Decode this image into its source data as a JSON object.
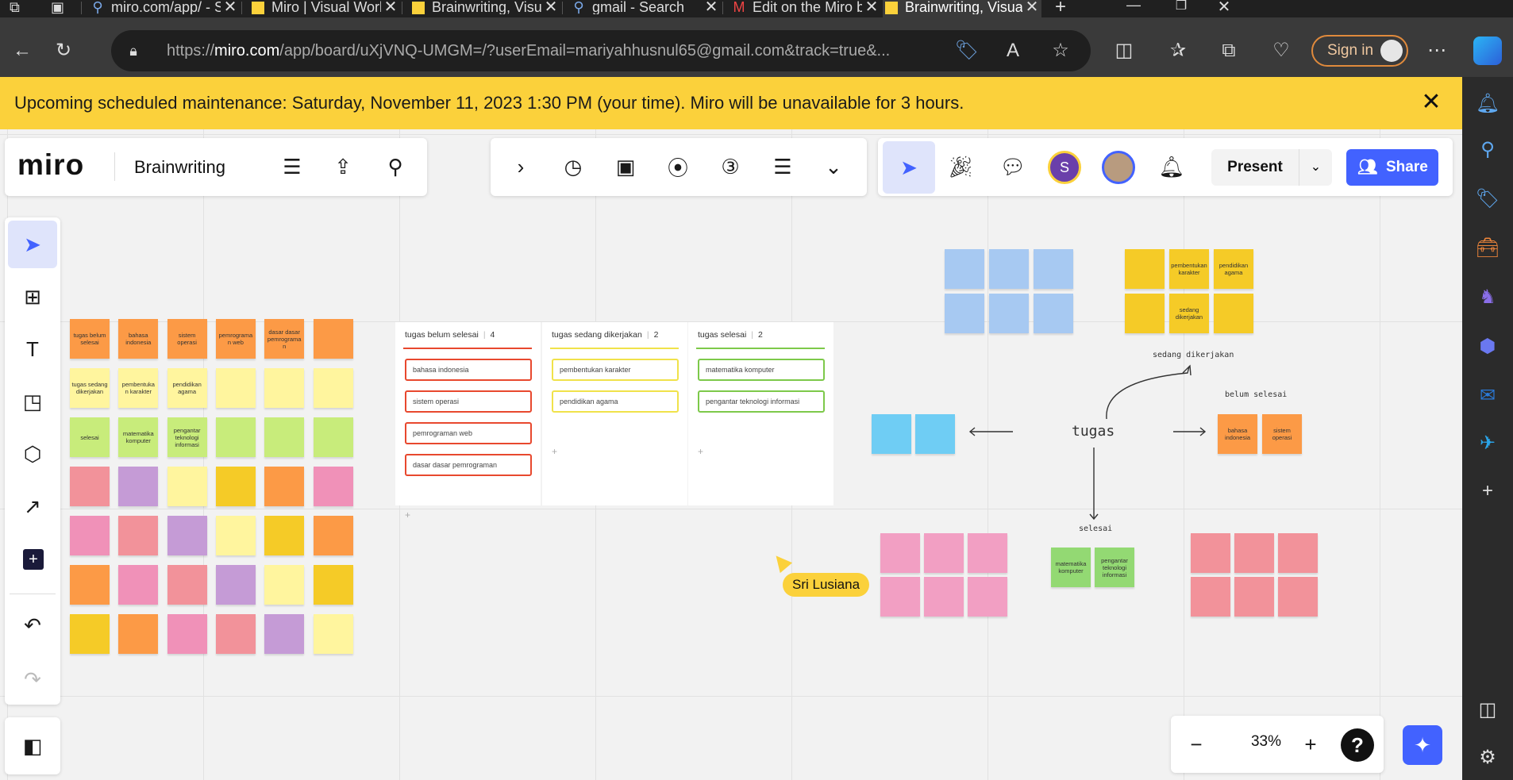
{
  "browser": {
    "tabs": [
      {
        "title": "miro.com/app/ - S",
        "active": false
      },
      {
        "title": "Miro | Visual Work",
        "active": false
      },
      {
        "title": "Brainwriting, Visua",
        "active": false
      },
      {
        "title": "gmail - Search",
        "active": false
      },
      {
        "title": "Edit on the Miro b",
        "active": false
      },
      {
        "title": "Brainwriting, Visua",
        "active": true
      }
    ],
    "url_prefix": "https://",
    "url_domain": "miro.com",
    "url_path": "/app/board/uXjVNQ-UMGM=/?userEmail=mariyahhusnul65@gmail.com&track=true&...",
    "sign_in_label": "Sign in"
  },
  "banner": {
    "text": "Upcoming scheduled maintenance: Saturday, November 11, 2023 1:30 PM (your time). Miro will be unavailable for 3 hours."
  },
  "board": {
    "logo": "miro",
    "name": "Brainwriting",
    "present_label": "Present",
    "share_label": "Share",
    "avatar_initial": "S",
    "zoom": "33%",
    "help": "?"
  },
  "cursor_user": "Sri Lusiana",
  "left_grid": [
    [
      {
        "c": "orange",
        "t": "tugas belum selesai"
      },
      {
        "c": "orange",
        "t": "bahasa indonesia"
      },
      {
        "c": "orange",
        "t": "sistem operasi"
      },
      {
        "c": "orange",
        "t": "pemrograma n web"
      },
      {
        "c": "orange",
        "t": "dasar dasar pemrograma n"
      },
      {
        "c": "orange",
        "t": ""
      }
    ],
    [
      {
        "c": "lyellow",
        "t": "tugas sedang dikerjakan"
      },
      {
        "c": "lyellow",
        "t": "pembentuka n karakter"
      },
      {
        "c": "lyellow",
        "t": "pendidikan agama"
      },
      {
        "c": "lyellow",
        "t": ""
      },
      {
        "c": "lyellow",
        "t": ""
      },
      {
        "c": "lyellow",
        "t": ""
      }
    ],
    [
      {
        "c": "green",
        "t": "selesai"
      },
      {
        "c": "green",
        "t": "matematika komputer"
      },
      {
        "c": "green",
        "t": "pengantar teknologi informasi"
      },
      {
        "c": "green",
        "t": ""
      },
      {
        "c": "green",
        "t": ""
      },
      {
        "c": "green",
        "t": ""
      }
    ],
    [
      {
        "c": "salmon",
        "t": ""
      },
      {
        "c": "purple",
        "t": ""
      },
      {
        "c": "lyellow",
        "t": ""
      },
      {
        "c": "yellow",
        "t": ""
      },
      {
        "c": "orange",
        "t": ""
      },
      {
        "c": "pink",
        "t": ""
      }
    ],
    [
      {
        "c": "pink",
        "t": ""
      },
      {
        "c": "salmon",
        "t": ""
      },
      {
        "c": "purple",
        "t": ""
      },
      {
        "c": "lyellow",
        "t": ""
      },
      {
        "c": "yellow",
        "t": ""
      },
      {
        "c": "orange",
        "t": ""
      }
    ],
    [
      {
        "c": "orange",
        "t": ""
      },
      {
        "c": "pink",
        "t": ""
      },
      {
        "c": "salmon",
        "t": ""
      },
      {
        "c": "purple",
        "t": ""
      },
      {
        "c": "lyellow",
        "t": ""
      },
      {
        "c": "yellow",
        "t": ""
      }
    ],
    [
      {
        "c": "yellow",
        "t": ""
      },
      {
        "c": "orange",
        "t": ""
      },
      {
        "c": "pink",
        "t": ""
      },
      {
        "c": "salmon",
        "t": ""
      },
      {
        "c": "purple",
        "t": ""
      },
      {
        "c": "lyellow",
        "t": ""
      }
    ]
  ],
  "kanban": [
    {
      "title": "tugas belum selesai",
      "count": "4",
      "color": "#e8482e",
      "cards": [
        "bahasa indonesia",
        "sistem operasi",
        "pemrograman web",
        "dasar dasar pemrograman"
      ]
    },
    {
      "title": "tugas sedang dikerjakan",
      "count": "2",
      "color": "#f0e24a",
      "cards": [
        "pembentukan karakter",
        "pendidikan agama"
      ]
    },
    {
      "title": "tugas selesai",
      "count": "2",
      "color": "#7dc94a",
      "cards": [
        "matematika komputer",
        "pengantar teknologi informasi"
      ]
    }
  ],
  "mindmap": {
    "center": "tugas",
    "top_label": "sedang dikerjakan",
    "right_label": "belum selesai",
    "bottom_label": "selesai",
    "yellow_notes": [
      "",
      "pembentukan karakter",
      "pendidikan agama",
      "",
      "sedang dikerjakan",
      ""
    ],
    "orange_notes": [
      "bahasa indonesia",
      "sistem operasi"
    ],
    "green_notes": [
      "matematika komputer",
      "pengantar teknologi informasi"
    ]
  },
  "colors": {
    "banner": "#fbd13b",
    "share": "#4262ff",
    "cursor": "#fbd13b"
  }
}
